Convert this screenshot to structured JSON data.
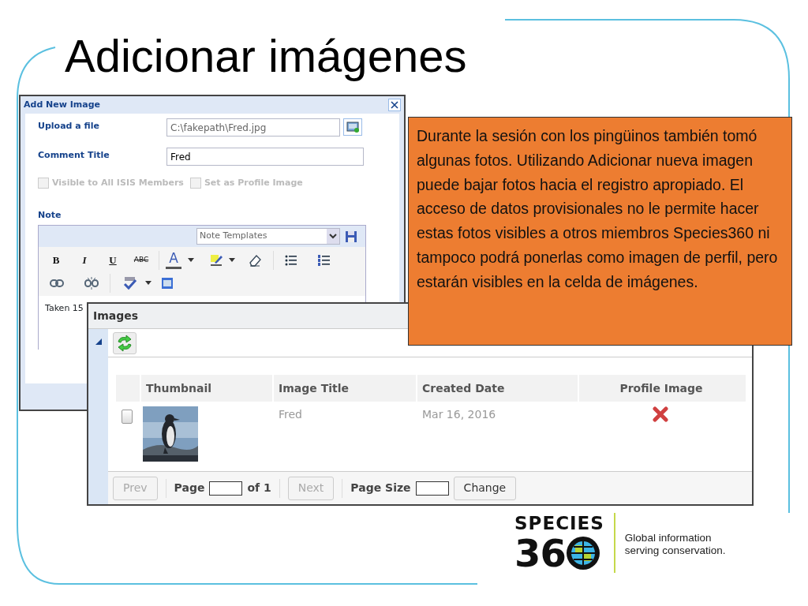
{
  "slide": {
    "title": "Adicionar imágenes"
  },
  "add_image_dialog": {
    "title": "Add New Image",
    "fields": [
      {
        "kind": "file",
        "label": "Upload a file",
        "value": "C:\\fakepath\\Fred.jpg"
      },
      {
        "kind": "text",
        "label": "Comment Title",
        "value": "Fred"
      }
    ],
    "checkboxes": [
      {
        "label": "Visible to All ISIS Members",
        "checked": false,
        "disabled": true
      },
      {
        "label": "Set as Profile Image",
        "checked": false,
        "disabled": true
      }
    ],
    "note_label": "Note",
    "template_select": {
      "placeholder": "Note Templates"
    },
    "format_buttons": [
      "B",
      "I",
      "U",
      "ABC"
    ],
    "font_color_label": "A",
    "note_text": "Taken 15"
  },
  "images_panel": {
    "title": "Images",
    "columns": [
      "Thumbnail",
      "Image Title",
      "Created Date",
      "Profile Image"
    ],
    "rows": [
      {
        "selected": false,
        "title": "Fred",
        "created": "Mar 16, 2016",
        "profile_image": false
      }
    ],
    "pager": {
      "prev": {
        "label": "Prev",
        "disabled": true
      },
      "page_label": "Page",
      "of_label": "of 1",
      "next": {
        "label": "Next",
        "disabled": true
      },
      "page_size_label": "Page Size",
      "change": {
        "label": "Change",
        "disabled": false
      }
    }
  },
  "callout": {
    "text": "Durante la sesión con los pingüinos también tomó algunas fotos.  Utilizando Adicionar nueva imagen puede bajar fotos hacia el registro apropiado.  El acceso de datos provisionales no le permite hacer estas fotos visibles a otros miembros Species360 ni tampoco podrá ponerlas como imagen de perfil, pero estarán visibles en la celda de imágenes."
  },
  "logo": {
    "wordmark": "SPECIES",
    "number": "36",
    "tagline": [
      "Global information",
      "serving conservation."
    ]
  }
}
